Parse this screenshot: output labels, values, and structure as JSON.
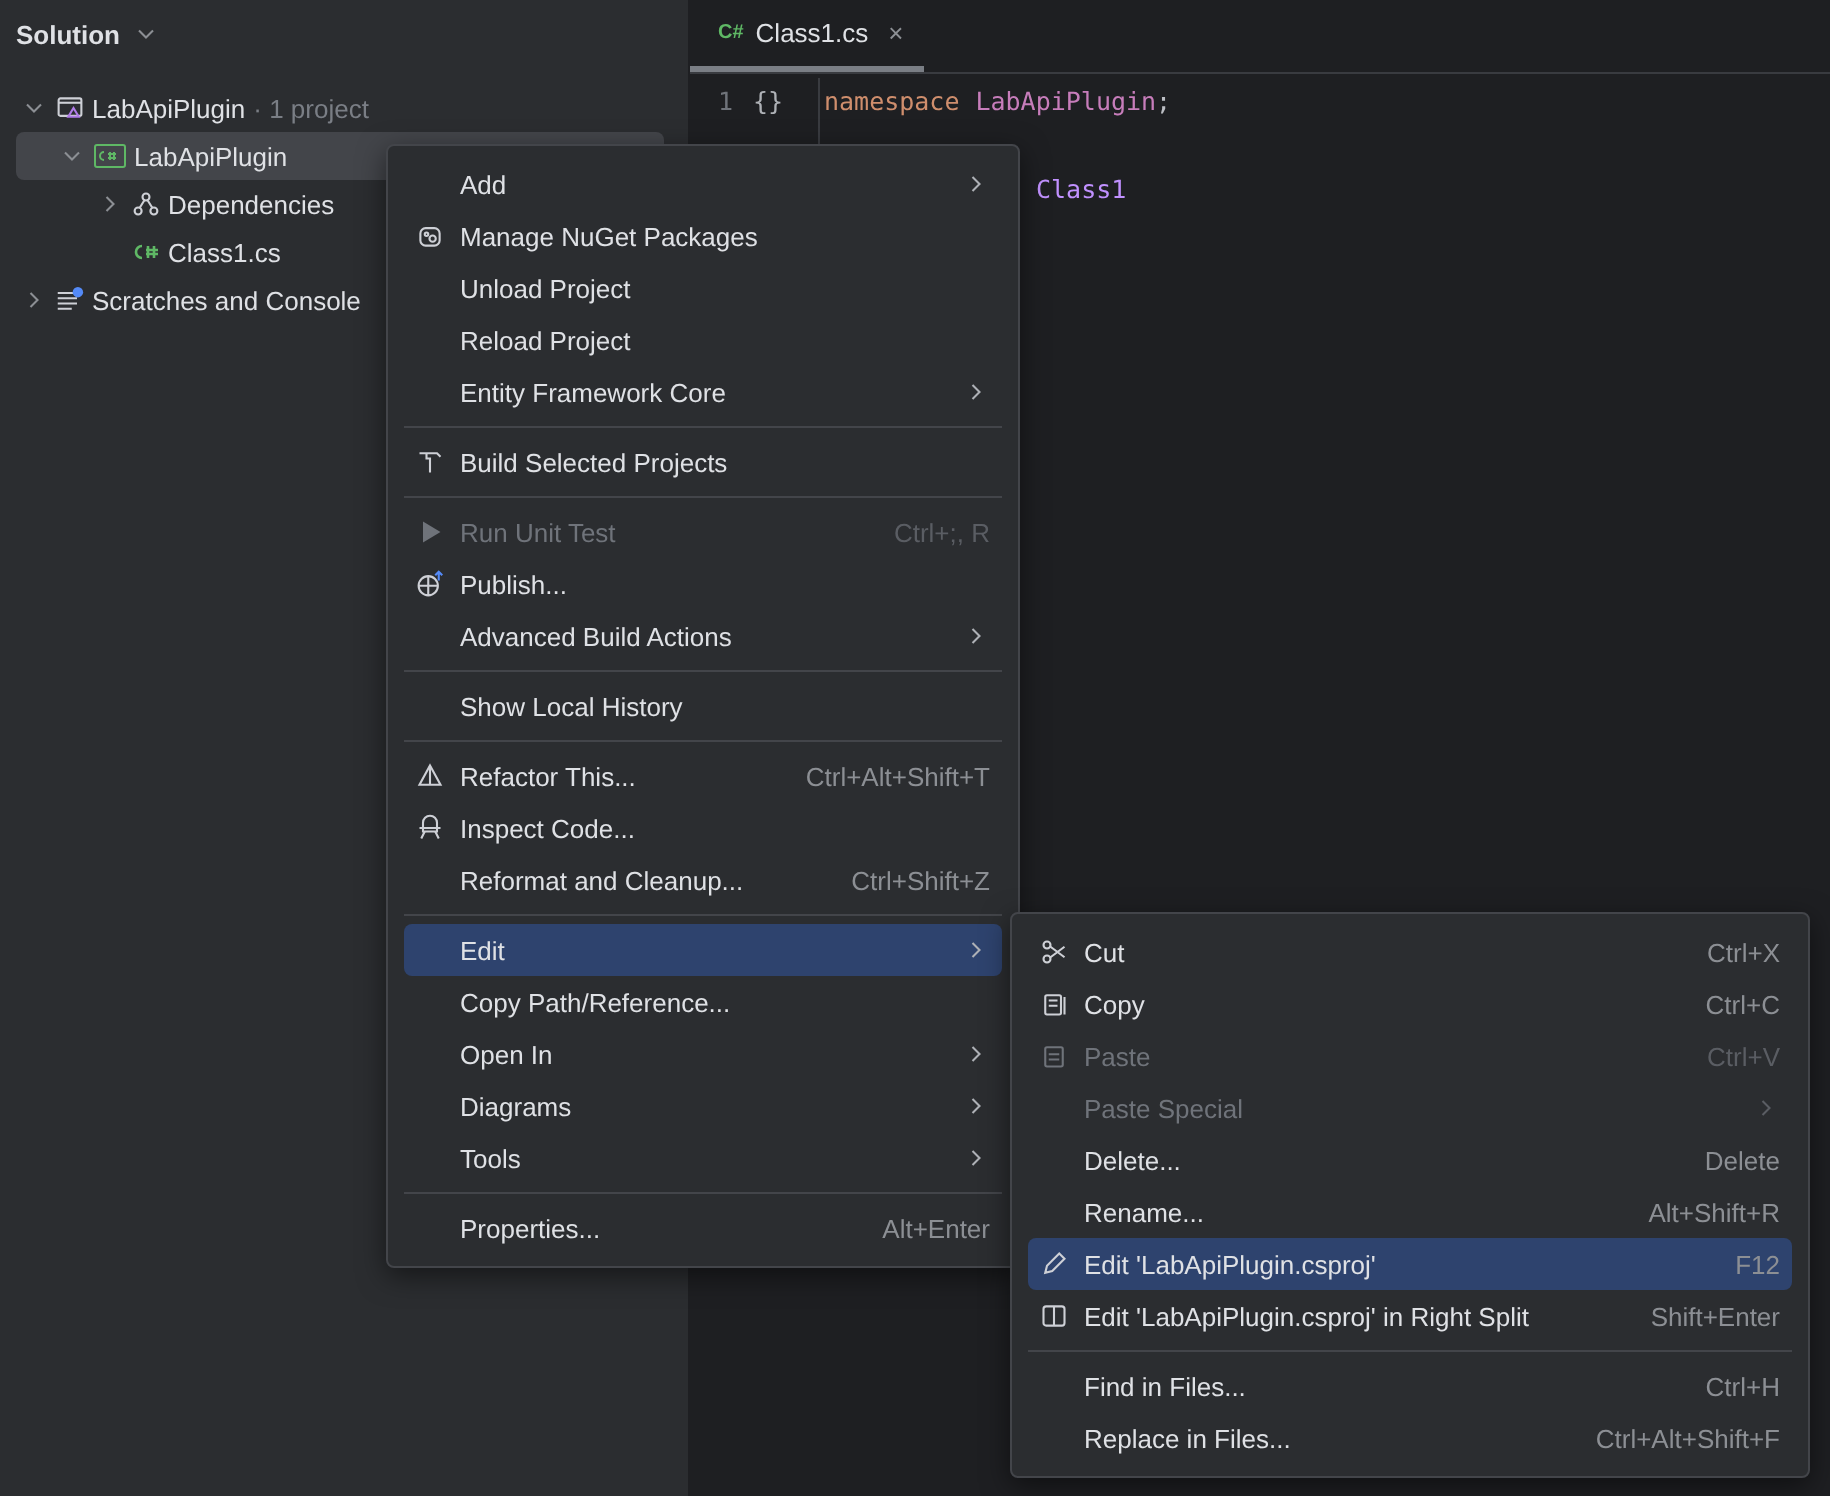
{
  "sidebar": {
    "title": "Solution",
    "tree": [
      {
        "label": "LabApiPlugin",
        "note": "· 1 project",
        "kind": "solution",
        "expanded": true,
        "selected": false,
        "children": [
          {
            "label": "LabApiPlugin",
            "kind": "project",
            "expanded": true,
            "selected": true,
            "children": [
              {
                "label": "Dependencies",
                "kind": "dependencies",
                "expanded": false,
                "selected": false
              },
              {
                "label": "Class1.cs",
                "kind": "file",
                "selected": false
              }
            ]
          }
        ]
      },
      {
        "label": "Scratches and Console",
        "kind": "scratches",
        "expanded": false,
        "selected": false
      }
    ]
  },
  "editor": {
    "tab": {
      "icon_text": "C#",
      "label": "Class1.cs",
      "close": "×"
    },
    "lines": [
      {
        "number": "1",
        "fold": "{}",
        "tokens": [
          {
            "text": "namespace",
            "kind": "keyword"
          },
          {
            "text": "LabApiPlugin",
            "kind": "name"
          },
          {
            "text": ";",
            "kind": "plain"
          }
        ]
      },
      {
        "tokens": [
          {
            "text": "Class1",
            "kind": "class"
          }
        ]
      }
    ]
  },
  "context_menu": {
    "items": [
      {
        "kind": "item",
        "label": "Add",
        "submenu": true,
        "disabled": false,
        "selected": false
      },
      {
        "kind": "item",
        "label": "Manage NuGet Packages",
        "disabled": false,
        "selected": false
      },
      {
        "kind": "item",
        "label": "Unload Project",
        "disabled": false,
        "selected": false
      },
      {
        "kind": "item",
        "label": "Reload Project",
        "disabled": false,
        "selected": false
      },
      {
        "kind": "item",
        "label": "Entity Framework Core",
        "submenu": true,
        "disabled": false,
        "selected": false
      },
      {
        "kind": "separator"
      },
      {
        "kind": "item",
        "label": "Build Selected Projects",
        "disabled": false,
        "selected": false
      },
      {
        "kind": "separator"
      },
      {
        "kind": "item",
        "label": "Run Unit Test",
        "shortcut": "Ctrl+;, R",
        "disabled": true,
        "selected": false
      },
      {
        "kind": "item",
        "label": "Publish...",
        "disabled": false,
        "selected": false
      },
      {
        "kind": "item",
        "label": "Advanced Build Actions",
        "submenu": true,
        "disabled": false,
        "selected": false
      },
      {
        "kind": "separator"
      },
      {
        "kind": "item",
        "label": "Show Local History",
        "disabled": false,
        "selected": false
      },
      {
        "kind": "separator"
      },
      {
        "kind": "item",
        "label": "Refactor This...",
        "shortcut": "Ctrl+Alt+Shift+T",
        "disabled": false,
        "selected": false
      },
      {
        "kind": "item",
        "label": "Inspect Code...",
        "disabled": false,
        "selected": false
      },
      {
        "kind": "item",
        "label": "Reformat and Cleanup...",
        "shortcut": "Ctrl+Shift+Z",
        "disabled": false,
        "selected": false
      },
      {
        "kind": "separator"
      },
      {
        "kind": "item",
        "label": "Edit",
        "submenu": true,
        "disabled": false,
        "selected": true
      },
      {
        "kind": "item",
        "label": "Copy Path/Reference...",
        "disabled": false,
        "selected": false
      },
      {
        "kind": "item",
        "label": "Open In",
        "submenu": true,
        "disabled": false,
        "selected": false
      },
      {
        "kind": "item",
        "label": "Diagrams",
        "submenu": true,
        "disabled": false,
        "selected": false
      },
      {
        "kind": "item",
        "label": "Tools",
        "submenu": true,
        "disabled": false,
        "selected": false
      },
      {
        "kind": "separator"
      },
      {
        "kind": "item",
        "label": "Properties...",
        "shortcut": "Alt+Enter",
        "disabled": false,
        "selected": false
      }
    ]
  },
  "submenu": {
    "items": [
      {
        "kind": "item",
        "label": "Cut",
        "shortcut": "Ctrl+X",
        "disabled": false,
        "selected": false
      },
      {
        "kind": "item",
        "label": "Copy",
        "shortcut": "Ctrl+C",
        "disabled": false,
        "selected": false
      },
      {
        "kind": "item",
        "label": "Paste",
        "shortcut": "Ctrl+V",
        "disabled": true,
        "selected": false
      },
      {
        "kind": "item",
        "label": "Paste Special",
        "submenu": true,
        "disabled": true,
        "selected": false
      },
      {
        "kind": "item",
        "label": "Delete...",
        "shortcut": "Delete",
        "disabled": false,
        "selected": false
      },
      {
        "kind": "item",
        "label": "Rename...",
        "shortcut": "Alt+Shift+R",
        "disabled": false,
        "selected": false
      },
      {
        "kind": "item",
        "label": "Edit 'LabApiPlugin.csproj'",
        "shortcut": "F12",
        "disabled": false,
        "selected": true
      },
      {
        "kind": "item",
        "label": "Edit 'LabApiPlugin.csproj' in Right Split",
        "shortcut": "Shift+Enter",
        "disabled": false,
        "selected": false
      },
      {
        "kind": "separator"
      },
      {
        "kind": "item",
        "label": "Find in Files...",
        "shortcut": "Ctrl+H",
        "disabled": false,
        "selected": false
      },
      {
        "kind": "item",
        "label": "Replace in Files...",
        "shortcut": "Ctrl+Alt+Shift+F",
        "disabled": false,
        "selected": false
      }
    ]
  }
}
